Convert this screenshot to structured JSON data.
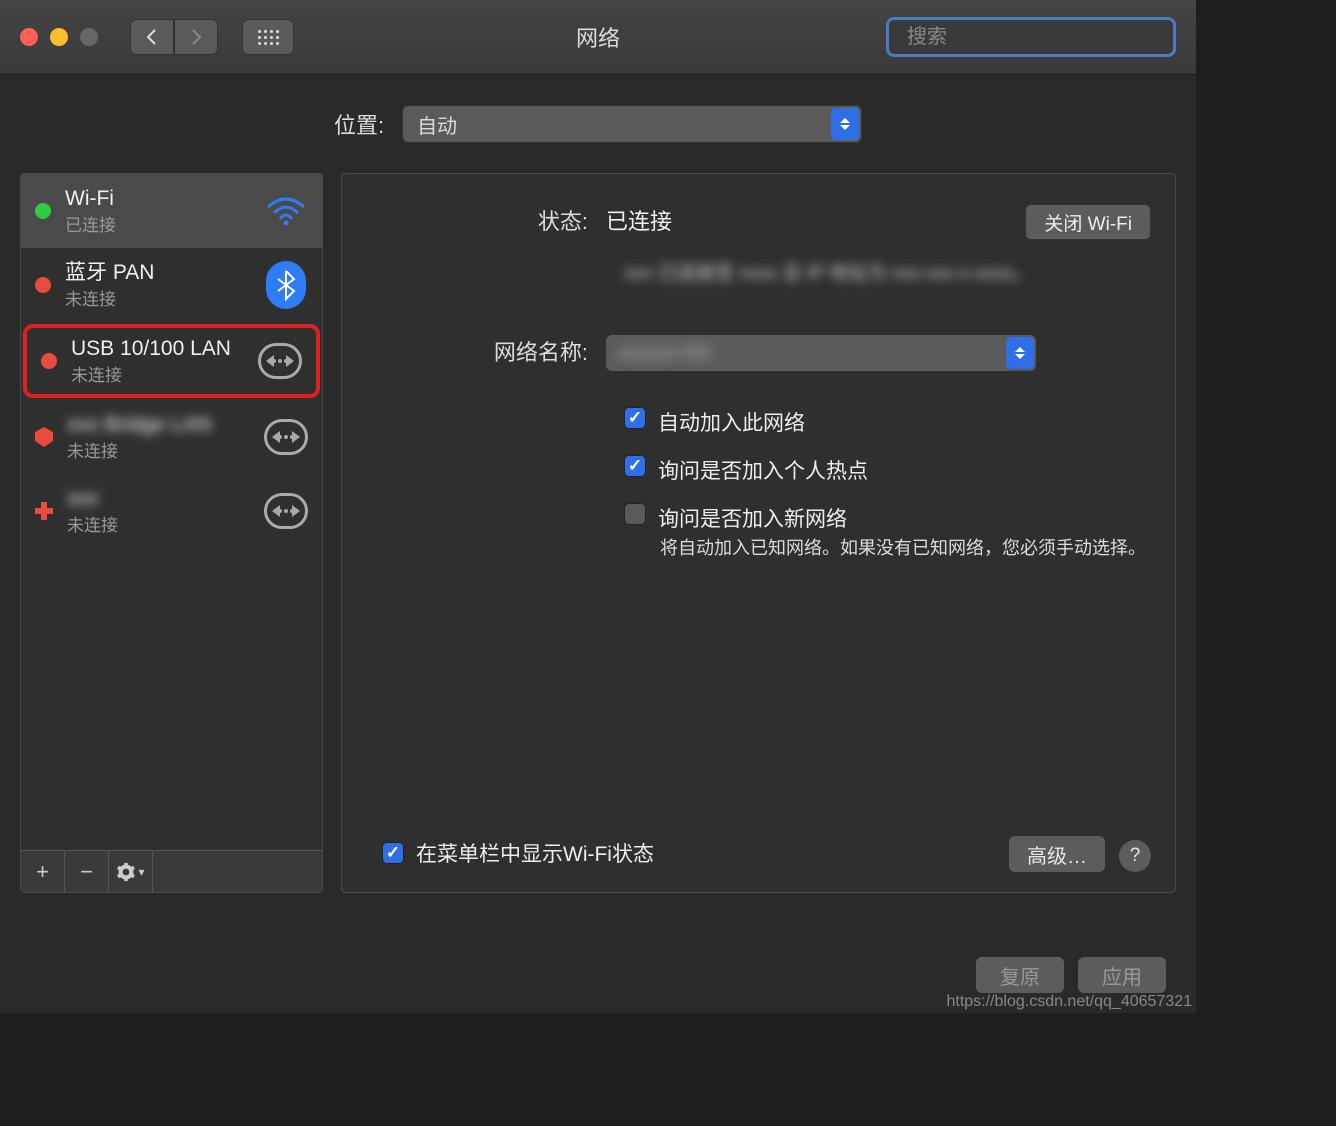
{
  "window": {
    "title": "网络",
    "search_placeholder": "搜索"
  },
  "location": {
    "label": "位置:",
    "value": "自动"
  },
  "connections": [
    {
      "name": "Wi-Fi",
      "status": "已连接",
      "dot": "green",
      "icon": "wifi",
      "selected": true
    },
    {
      "name": "蓝牙 PAN",
      "status": "未连接",
      "dot": "red",
      "icon": "bluetooth"
    },
    {
      "name": "USB 10/100 LAN",
      "status": "未连接",
      "dot": "red",
      "icon": "arrows",
      "highlighted": true
    },
    {
      "name": "xxx Bridge LAN",
      "status": "未连接",
      "dot": "shield",
      "icon": "arrows",
      "blurred": true
    },
    {
      "name": "xxx",
      "status": "未连接",
      "dot": "plus",
      "icon": "arrows",
      "blurred": true
    }
  ],
  "detail": {
    "status_label": "状态:",
    "status_value": "已连接",
    "wifi_off_button": "关闭 Wi-Fi",
    "status_info": "xxx 已连接至 xxxx 且 IP 地址为 xxx.xxx.x.xxxx。",
    "network_name_label": "网络名称:",
    "network_name_value": "xxxxxx-5G",
    "checkboxes": {
      "auto_join": {
        "label": "自动加入此网络",
        "checked": true
      },
      "ask_hotspot": {
        "label": "询问是否加入个人热点",
        "checked": true
      },
      "ask_new": {
        "label": "询问是否加入新网络",
        "checked": false
      }
    },
    "hint": "将自动加入已知网络。如果没有已知网络，您必须手动选择。",
    "show_menubar": {
      "label": "在菜单栏中显示Wi-Fi状态",
      "checked": true
    },
    "advanced_button": "高级…",
    "help_button": "?"
  },
  "footer": {
    "revert": "复原",
    "apply": "应用"
  },
  "watermark": "https://blog.csdn.net/qq_40657321"
}
